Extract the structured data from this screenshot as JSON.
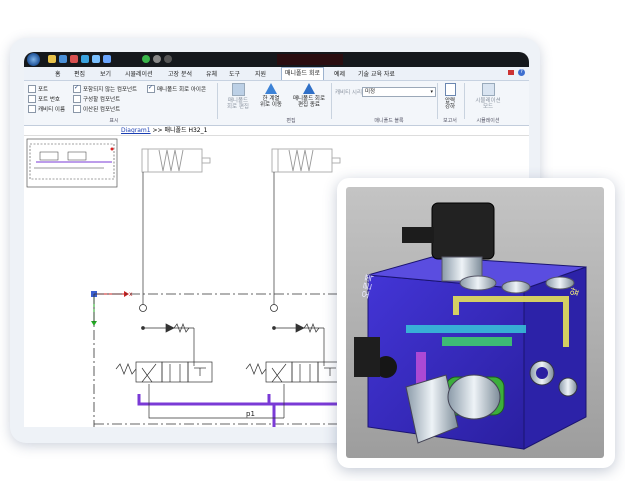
{
  "menu": {
    "tabs": [
      "홈",
      "편집",
      "보기",
      "시뮬레이션",
      "고장 분석",
      "유체",
      "도구",
      "지원",
      "매니폴드 회로",
      "예제",
      "기술 교육 자료"
    ],
    "active_tab": "매니폴드 회로"
  },
  "ribbon": {
    "display_group": {
      "title": "표시",
      "options": [
        {
          "label": "포트",
          "checked": false
        },
        {
          "label": "포트 번호",
          "checked": false
        },
        {
          "label": "캐비티 이름",
          "checked": false
        },
        {
          "label": "포함되지 않는 컴포넌트",
          "checked": true
        },
        {
          "label": "구성할 컴포넌트",
          "checked": false
        },
        {
          "label": "이산된 컴포넌트",
          "checked": false
        },
        {
          "label": "매니폴드 회로 아이콘",
          "checked": true
        }
      ]
    },
    "edit_group": {
      "title": "편집",
      "buttons": [
        {
          "line1": "매니폴드",
          "line2": "회로 편집"
        },
        {
          "line1": "한 계열",
          "line2": "위로 이동"
        },
        {
          "line1": "매니폴드 회로",
          "line2": "편집 종료"
        }
      ]
    },
    "library_group": {
      "title": "매니폴드 블록",
      "combo_label": "캐비티 시리즈",
      "combo_value": "미정"
    },
    "report_group": {
      "title": "보고서",
      "button_line1": "압력",
      "button_line2": "강하"
    },
    "sim_group": {
      "title": "시뮬레이션",
      "button_line1": "시뮬레이션",
      "button_line2": "모드"
    }
  },
  "breadcrumb": {
    "link": "Diagram1",
    "separator": ">>",
    "current": "매니폴드 H32_1"
  },
  "diagram": {
    "pressure_label": "p1"
  },
  "block": {
    "left_face": "오른쪽",
    "right_face": "앞"
  },
  "colors": {
    "pressure_line": "#7a3ad6",
    "block": "#3a2fc0",
    "bg_3d": "#b8b8b8"
  }
}
